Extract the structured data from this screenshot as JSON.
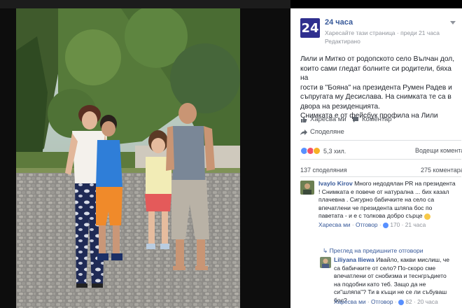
{
  "page": {
    "name": "24 часа",
    "logo_text": "24",
    "like_page": "Харесайте тази страница",
    "separator": "·",
    "time": "преди 21 часа",
    "edited": "Редактирано"
  },
  "post": {
    "lines": [
      "Лили и Митко от родопското село Вълчан дол,",
      "които сами гледат болните си родители, бяха на",
      "гости в \"Бояна\" на президента Румен Радев и",
      "съпругата му Десислава. На снимката те са в",
      "двора на резиденцията.",
      "Снимката е от фейсбук профила на Лили"
    ]
  },
  "actions": {
    "like": "Харесва ми",
    "comment": "Коментар",
    "share": "Споделяне"
  },
  "stats": {
    "reactions": "5,3 хил.",
    "top_comments": "Водещи коментари",
    "shares": "137 споделяния",
    "comments": "275 коментара"
  },
  "comments": [
    {
      "author": "Ivaylo Kirov",
      "lines": [
        " Много недодялан PR на президента",
        "! Снимката е повече от натурална ... бих казал",
        "плачевна . Сигурно бабичките на село са",
        "впечатлени че президента шляпа бос по",
        "паветата - и е с толкова добро сърце "
      ],
      "like": "Харесва ми",
      "reply": "Отговор",
      "count": "170",
      "time": "21 часа"
    },
    {
      "author": "Liliyana Iliewa",
      "lines": [
        " Ивайло, какви мислиш, че",
        "са бабичките от село? По-скоро сме",
        "впечатлени от снобизма и теснгръдието",
        "на подобни като теб. Защо да не",
        "си\"шляпа\"? Ти в къщи не се ли събуваш",
        "бос?"
      ],
      "like": "Харесва ми",
      "reply": "Отговор",
      "count": "82",
      "time": "20 часа"
    }
  ],
  "previous_replies": "Преглед на предишните отговори",
  "colors": {
    "brand": "#2f2f8e",
    "link": "#365899",
    "muted": "#90949c"
  },
  "icons": [
    "chevron-down-icon",
    "like-icon",
    "comment-icon",
    "share-icon",
    "reply-arrow-icon",
    "smile-emoji-icon"
  ]
}
